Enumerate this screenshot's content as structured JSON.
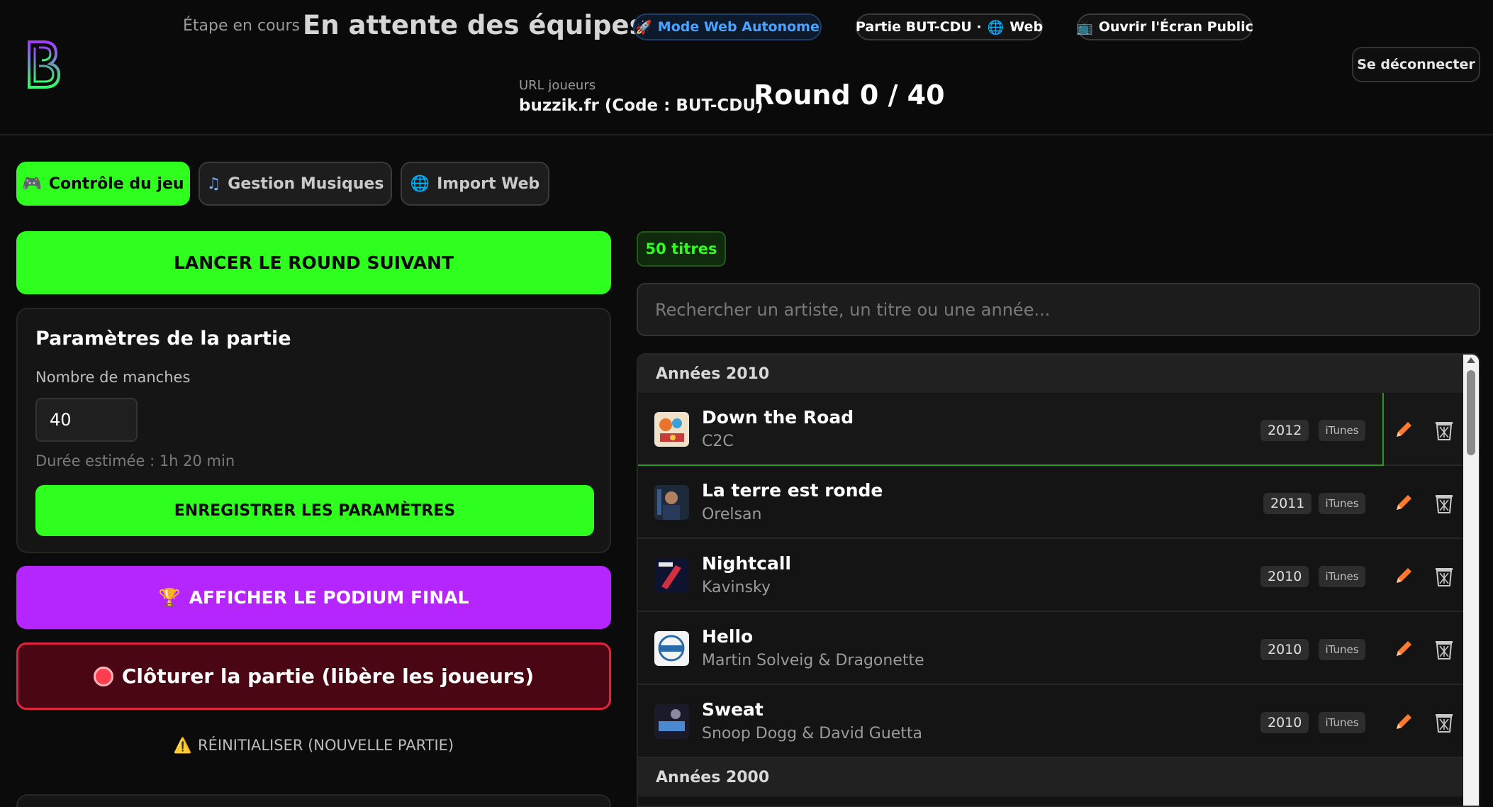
{
  "header": {
    "stage_label": "Étape en cours",
    "stage_value": "En attente des équipes",
    "mode_pill": "Mode Web Autonome",
    "partie_pill": "Partie BUT-CDU · ",
    "partie_pill_web": "Web",
    "ecran_pill": "Ouvrir l'Écran Public",
    "logout": "Se déconnecter",
    "url_label": "URL joueurs",
    "url_value": "buzzik.fr (Code : BUT-CDU)",
    "round": "Round 0 / 40"
  },
  "tabs": [
    {
      "label": "Contrôle du jeu",
      "icon": "gamepad-icon",
      "active": true
    },
    {
      "label": "Gestion Musiques",
      "icon": "music-note-icon",
      "active": false
    },
    {
      "label": "Import Web",
      "icon": "globe-icon",
      "active": false
    }
  ],
  "controls": {
    "launch_label": "LANCER LE ROUND SUIVANT",
    "params_title": "Paramètres de la partie",
    "rounds_label": "Nombre de manches",
    "rounds_value": "40",
    "duration": "Durée estimée : 1h 20 min",
    "save_label": "ENREGISTRER LES PARAMÈTRES",
    "podium_label": "AFFICHER LE PODIUM FINAL",
    "close_label": "Clôturer la partie (libère les joueurs)",
    "reset_label": "RÉINITIALISER (NOUVELLE PARTIE)"
  },
  "library": {
    "count": "50 titres",
    "search_placeholder": "Rechercher un artiste, un titre ou une année...",
    "groups": [
      {
        "label": "Années 2010",
        "songs": [
          {
            "title": "Down the Road",
            "artist": "C2C",
            "year": "2012",
            "source": "iTunes"
          },
          {
            "title": "La terre est ronde",
            "artist": "Orelsan",
            "year": "2011",
            "source": "iTunes"
          },
          {
            "title": "Nightcall",
            "artist": "Kavinsky",
            "year": "2010",
            "source": "iTunes"
          },
          {
            "title": "Hello",
            "artist": "Martin Solveig & Dragonette",
            "year": "2010",
            "source": "iTunes"
          },
          {
            "title": "Sweat",
            "artist": "Snoop Dogg & David Guetta",
            "year": "2010",
            "source": "iTunes"
          }
        ]
      },
      {
        "label": "Années 2000",
        "songs": []
      }
    ]
  },
  "colors": {
    "accent_green": "#2eff1e",
    "podium_purple": "#b526ff",
    "danger_red": "#e0243f",
    "mode_blue": "#4aa3ff",
    "edit_orange": "#ff7a2e"
  }
}
